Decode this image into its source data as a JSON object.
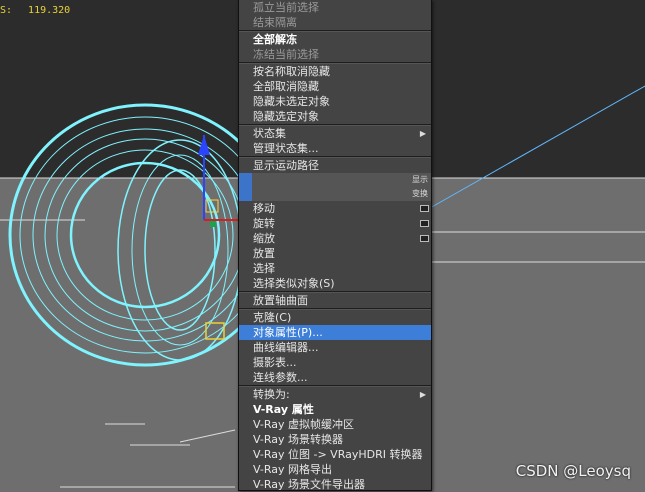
{
  "viewport": {
    "coord_label": "S:",
    "coord_value": "119.320"
  },
  "menu": {
    "items": [
      {
        "label": "孤立当前选择",
        "style": "dis"
      },
      {
        "label": "结束隔离",
        "style": "dis"
      },
      {
        "type": "sep"
      },
      {
        "label": "全部解冻",
        "style": "bold"
      },
      {
        "label": "冻结当前选择",
        "style": "dis"
      },
      {
        "type": "sep"
      },
      {
        "label": "按名称取消隐藏",
        "style": "normal"
      },
      {
        "label": "全部取消隐藏",
        "style": "normal"
      },
      {
        "label": "隐藏未选定对象",
        "style": "normal"
      },
      {
        "label": "隐藏选定对象",
        "style": "normal"
      },
      {
        "type": "sep"
      },
      {
        "label": "状态集",
        "style": "normal",
        "submenu": true
      },
      {
        "label": "管理状态集...",
        "style": "normal"
      },
      {
        "type": "sep"
      },
      {
        "label": "显示运动路径",
        "style": "normal"
      },
      {
        "type": "quad",
        "label": "显示"
      },
      {
        "type": "quad",
        "label": "变换"
      },
      {
        "label": "移动",
        "style": "normal",
        "option": true
      },
      {
        "label": "旋转",
        "style": "normal",
        "option": true
      },
      {
        "label": "缩放",
        "style": "normal",
        "option": true
      },
      {
        "label": "放置",
        "style": "normal"
      },
      {
        "label": "选择",
        "style": "normal"
      },
      {
        "label": "选择类似对象(S)",
        "style": "normal"
      },
      {
        "type": "sep"
      },
      {
        "label": "放置轴曲面",
        "style": "normal"
      },
      {
        "type": "sep"
      },
      {
        "label": "克隆(C)",
        "style": "normal"
      },
      {
        "label": "对象属性(P)...",
        "style": "hl"
      },
      {
        "label": "曲线编辑器...",
        "style": "normal"
      },
      {
        "label": "摄影表...",
        "style": "normal"
      },
      {
        "label": "连线参数...",
        "style": "normal"
      },
      {
        "type": "sep"
      },
      {
        "label": "转换为:",
        "style": "normal",
        "submenu": true
      },
      {
        "label": "V-Ray 属性",
        "style": "bold"
      },
      {
        "label": "V-Ray 虚拟帧缓冲区",
        "style": "normal"
      },
      {
        "label": "V-Ray 场景转换器",
        "style": "normal"
      },
      {
        "label": "V-Ray 位图 -> VRayHDRI 转换器",
        "style": "normal"
      },
      {
        "label": "V-Ray 网格导出",
        "style": "normal"
      },
      {
        "label": "V-Ray 场景文件导出器",
        "style": "normal"
      }
    ]
  },
  "watermark": "CSDN @Leoysq",
  "colors": {
    "wire": "#7ff4ff",
    "highlight": "#3d7fd8",
    "coord": "#e8d23a",
    "gizmo_z": "#2a44ff"
  }
}
